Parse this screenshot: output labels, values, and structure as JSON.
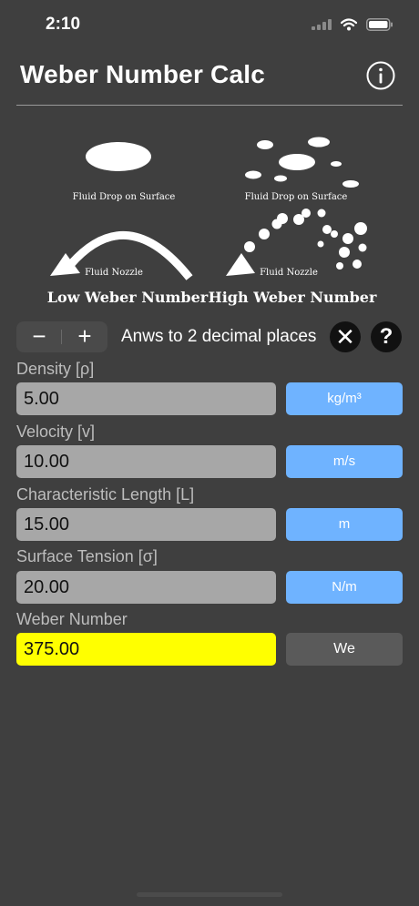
{
  "status": {
    "time": "2:10"
  },
  "header": {
    "title": "Weber Number Calc"
  },
  "illustration": {
    "drop_caption_low": "Fluid Drop on Surface",
    "drop_caption_high": "Fluid Drop on Surface",
    "nozzle_caption_low": "Fluid Nozzle",
    "nozzle_caption_high": "Fluid Nozzle",
    "low_label": "Low Weber Number",
    "high_label": "High Weber Number"
  },
  "controls": {
    "minus_label": "−",
    "plus_label": "+",
    "precision_text": "Anws to 2 decimal places",
    "clear_label": "✕",
    "help_label": "?"
  },
  "fields": [
    {
      "label": "Density [ρ]",
      "value": "5.00",
      "unit": "kg/m³"
    },
    {
      "label": "Velocity [v]",
      "value": "10.00",
      "unit": "m/s"
    },
    {
      "label": "Characteristic Length [L]",
      "value": "15.00",
      "unit": "m"
    },
    {
      "label": "Surface Tension [σ]",
      "value": "20.00",
      "unit": "N/m"
    }
  ],
  "result": {
    "label": "Weber Number",
    "value": "375.00",
    "unit": "We"
  },
  "colors": {
    "background": "#3f3f3f",
    "input": "#a7a7a7",
    "unit_button": "#6fb3ff",
    "result": "#ffff00"
  }
}
